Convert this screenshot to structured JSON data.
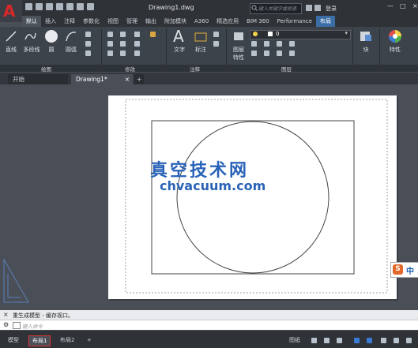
{
  "app": {
    "logo_letter": "A"
  },
  "titlebar": {
    "doc_title": "Drawing1.dwg",
    "search_placeholder": "键入关键字或短语",
    "signin_label": "登录",
    "window_controls": [
      "—",
      "□",
      "×"
    ]
  },
  "ribbon_tabs": [
    "默认",
    "插入",
    "注释",
    "参数化",
    "视图",
    "管理",
    "输出",
    "附加模块",
    "A360",
    "精选应用",
    "BIM 360",
    "Performance",
    "布局"
  ],
  "ribbon": {
    "draw_tools": [
      "直线",
      "多段线",
      "圆",
      "圆弧"
    ],
    "annot_tools": [
      "文字",
      "标注"
    ],
    "layer_tools": [
      "图层",
      "特性"
    ],
    "layer_value": "0",
    "block_label": "块",
    "props_label": "特性",
    "panel_labels": {
      "draw": "绘图",
      "modify": "修改",
      "annotation": "注释",
      "layers": "图层"
    }
  },
  "file_tabs": {
    "start": "开始",
    "drawing": "Drawing1*",
    "close_icon": "×",
    "add_icon": "+"
  },
  "watermark": {
    "cn": "真空技术网",
    "url": "chvacuum.com"
  },
  "command": {
    "history": "重生成模型 - 缓存视口。",
    "prompt_placeholder": "键入命令"
  },
  "layout_tabs": [
    "模型",
    "布局1",
    "布局2"
  ],
  "status": {
    "paper_label": "图纸"
  },
  "ime": {
    "s_label": "S",
    "lang": "中"
  },
  "colors": {
    "accent_red": "#d8282a",
    "dark_bg": "#2f3338",
    "canvas_bg": "#4a4f57",
    "paper": "#ffffff",
    "watermark_blue": "#2a63b8"
  }
}
